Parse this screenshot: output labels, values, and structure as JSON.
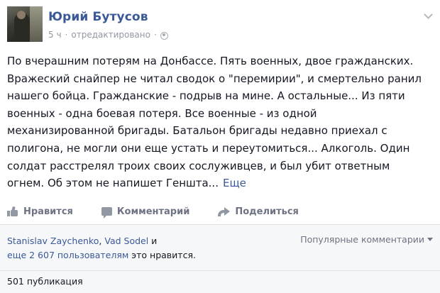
{
  "post": {
    "author": "Юрий Бутусов",
    "time": "5 ч",
    "edited": "отредактировано",
    "separator": "·",
    "icons": {
      "audience": "globe-icon",
      "options": "chevron-down-icon"
    },
    "text_lines": [
      "По вчерашним потерям на Донбассе. Пять военных, двое гражданских.",
      "Вражеский снайпер не читал сводок о \"перемирии\", и смертельно ранил",
      "нашего бойца. Гражданские - подрыв на мине. А остальные... Из пяти",
      "военных - одна боевая потеря. Все военные - из одной",
      "механизированной бригады. Батальон бригады недавно приехал с",
      "полигона, не могли они еще устать и переутомиться... Алкоголь. Один",
      "солдат расстрелял троих своих сослуживцев, и был убит ответным",
      "огнем. Об этом не напишет Геншта..."
    ],
    "more_label": "Еще"
  },
  "actions": {
    "like": "Нравится",
    "comment": "Комментарий",
    "share": "Поделиться"
  },
  "feedback": {
    "liker1": "Stanislav Zaychenko",
    "comma": ",",
    "liker2": "Vad Sodel",
    "and": " и",
    "others_link": "еще 2 607 пользователям",
    "likes_suffix": " это нравится.",
    "sort_label": "Популярные комментарии",
    "shares": "501 публикация"
  },
  "colors": {
    "link": "#3b5998",
    "text": "#141823",
    "muted": "#9197a3",
    "action": "#6d7383",
    "feedback_bg": "#f6f7f8"
  }
}
